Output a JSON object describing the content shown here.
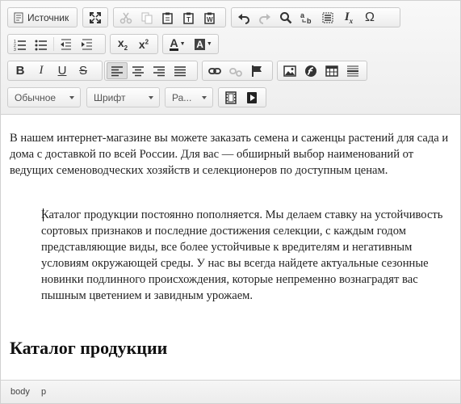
{
  "toolbar": {
    "source_label": "Источник",
    "format_combo": "Обычное",
    "font_combo": "Шрифт",
    "size_combo": "Ра...",
    "special_char": "Ω",
    "bold_glyph": "B",
    "italic_glyph": "I",
    "underline_glyph": "U",
    "strike_glyph": "S",
    "subscript_glyph": "x",
    "subscript_index": "2",
    "superscript_glyph": "x",
    "superscript_index": "2",
    "text_color_glyph": "A",
    "bg_color_glyph": "A",
    "remove_format_glyph": "I",
    "remove_format_index": "x"
  },
  "content": {
    "paragraph1": "В нашем интернет-магазине вы можете заказать семена и саженцы растений для сада и дома с доставкой по всей России. Для вас — обширный выбор наименований от ведущих семеноводческих хозяйств и селекционеров по доступным ценам.",
    "blockquote": "Каталог продукции постоянно пополняется. Мы делаем ставку на устойчивость сортовых признаков и последние достижения селекции, с каждым годом представляющие виды, все более устойчивые к вредителям и негативным условиям окружающей среды. У нас вы всегда найдете актуальные сезонные новинки подлинного происхождения, которые непременно вознаградят вас пышным цветением и завидным урожаем.",
    "heading": "Каталог продукции"
  },
  "statusbar": {
    "path": [
      "body",
      "p"
    ]
  }
}
